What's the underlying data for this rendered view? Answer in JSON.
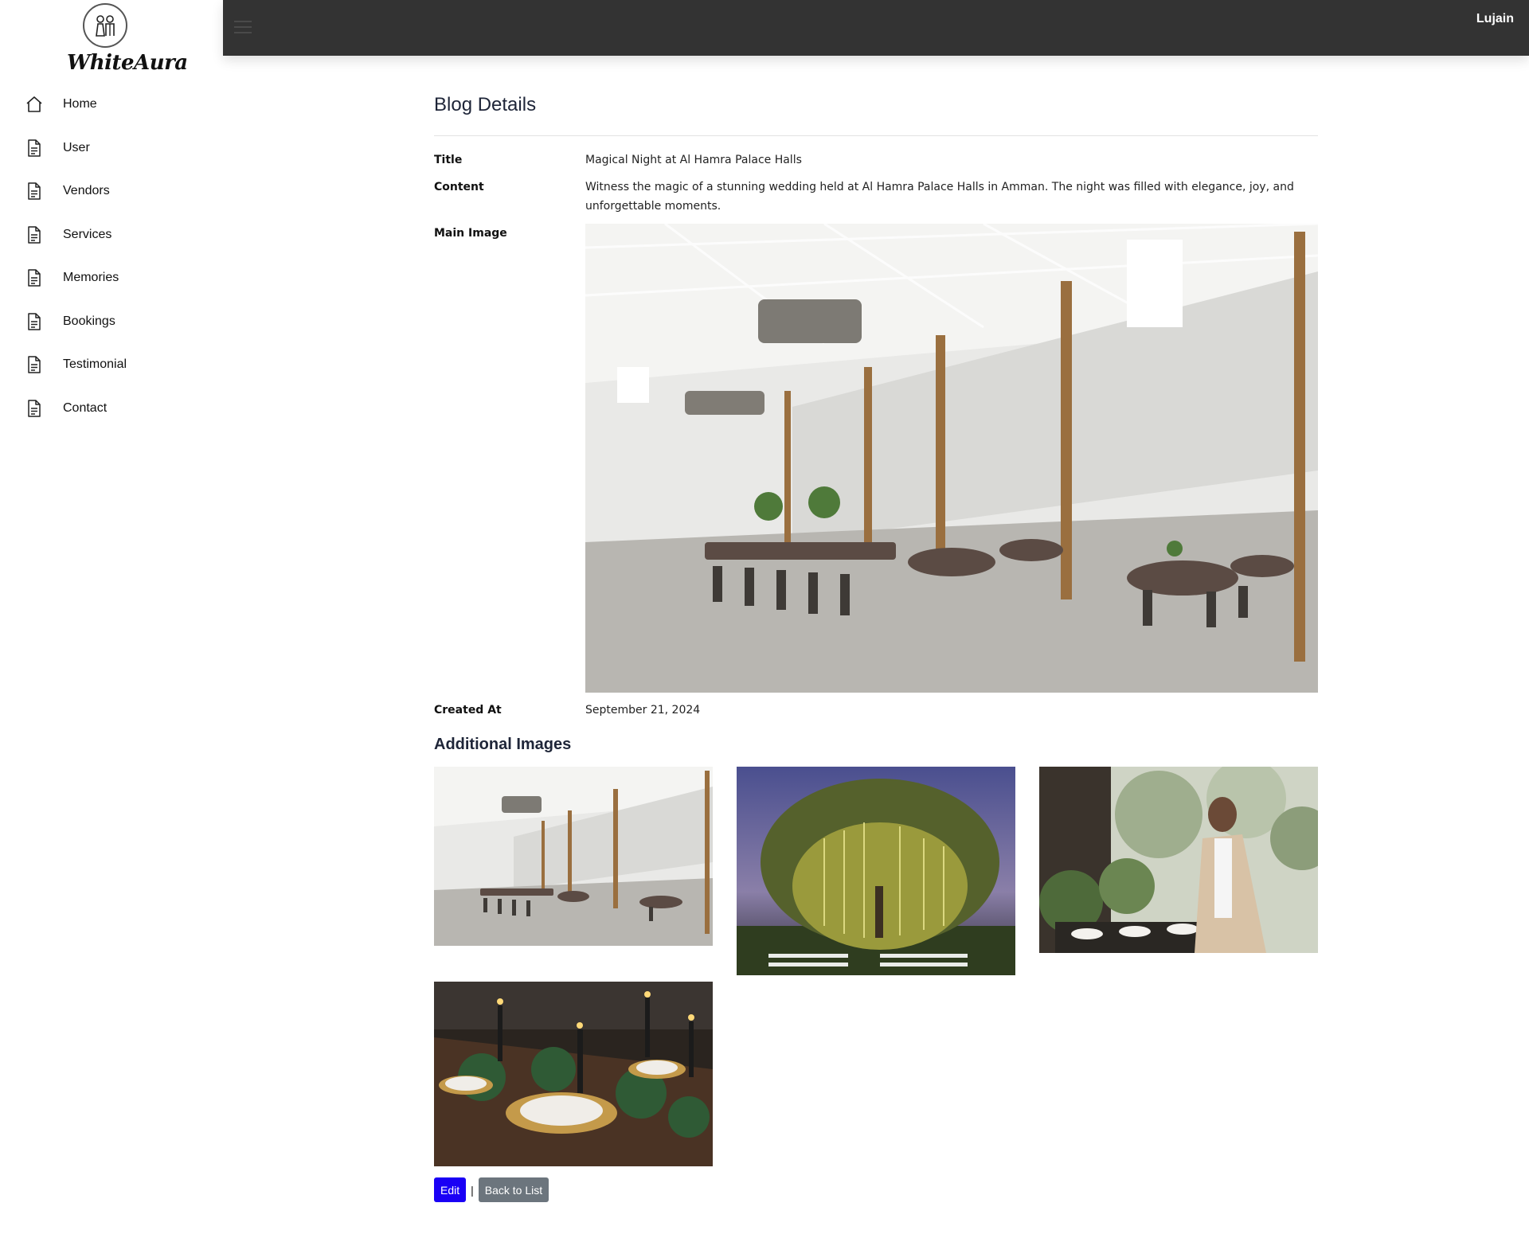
{
  "app": {
    "brand": "WhiteAura",
    "user": "Lujain"
  },
  "sidebar": {
    "items": [
      {
        "label": "Home",
        "icon": "home-icon"
      },
      {
        "label": "User",
        "icon": "document-icon"
      },
      {
        "label": "Vendors",
        "icon": "document-icon"
      },
      {
        "label": "Services",
        "icon": "document-icon"
      },
      {
        "label": "Memories",
        "icon": "document-icon"
      },
      {
        "label": "Bookings",
        "icon": "document-icon"
      },
      {
        "label": "Testimonial",
        "icon": "document-icon"
      },
      {
        "label": "Contact",
        "icon": "document-icon"
      }
    ]
  },
  "page": {
    "title": "Blog Details",
    "fields": {
      "title_label": "Title",
      "title_value": "Magical Night at Al Hamra Palace Halls",
      "content_label": "Content",
      "content_value": "Witness the magic of a stunning wedding held at Al Hamra Palace Halls in Amman. The night was filled with elegance, joy, and unforgettable moments.",
      "image_label": "Main Image",
      "created_label": "Created At",
      "created_value": "September 21, 2024"
    },
    "additional_title": "Additional Images",
    "actions": {
      "edit": "Edit",
      "separator": "|",
      "back": "Back to List"
    }
  },
  "colors": {
    "topbar": "#333333",
    "edit_button": "#1a00f5",
    "back_button": "#6c757d"
  }
}
